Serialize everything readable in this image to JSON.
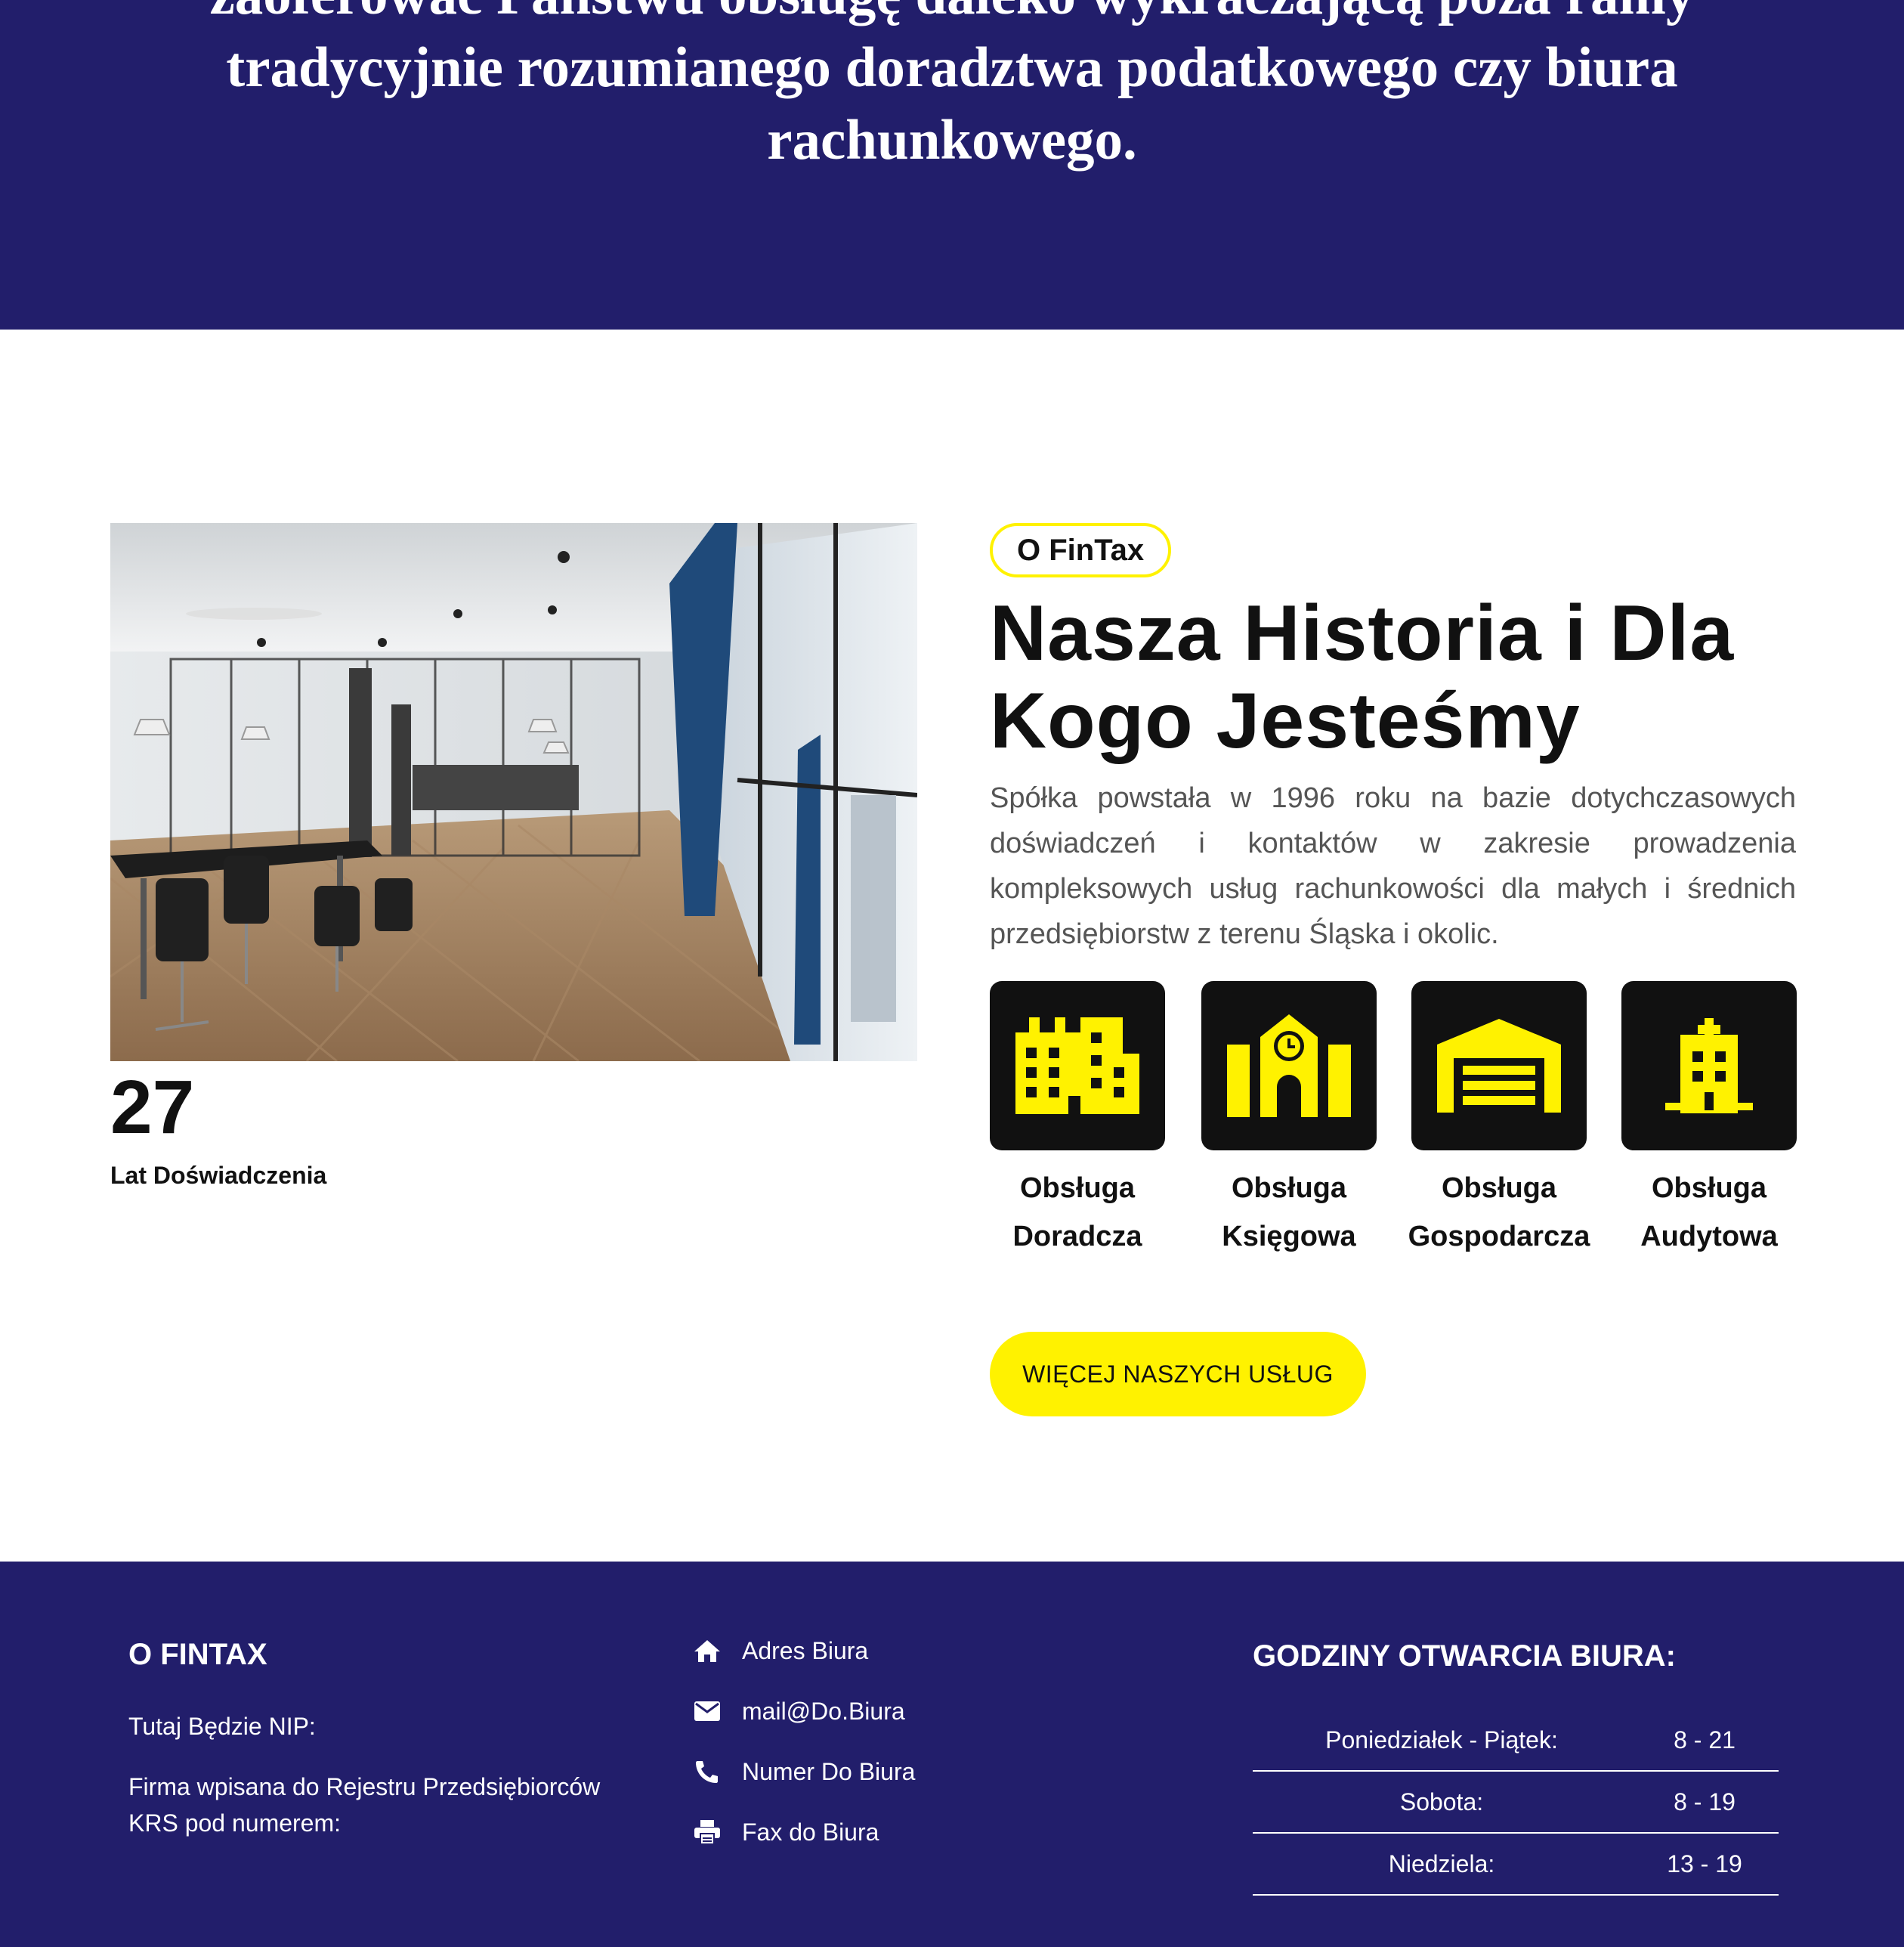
{
  "hero": {
    "line1": "zaoferować Państwu obsługę daleko wykraczającą poza ramy",
    "line2": "tradycyjnie rozumianego doradztwa podatkowego czy biura",
    "line3": "rachunkowego."
  },
  "about": {
    "badge": "O FinTax",
    "heading_line1": "Nasza Historia i Dla",
    "heading_line2": "Kogo Jesteśmy",
    "description": "Spółka powstała w 1996 roku na bazie dotychczasowych doświadczeń i kontaktów w zakresie prowadzenia kompleksowych usług rachunkowości dla małych i średnich przedsiębiorstw z terenu Śląska i okolic.",
    "stat_number": "27",
    "stat_label": "Lat Doświadczenia",
    "image_alt": "office-interior-photo",
    "services": [
      {
        "line1": "Obsługa",
        "line2": "Doradcza",
        "icon": "buildings-icon"
      },
      {
        "line1": "Obsługa",
        "line2": "Księgowa",
        "icon": "school-clock-icon"
      },
      {
        "line1": "Obsługa",
        "line2": "Gospodarcza",
        "icon": "warehouse-icon"
      },
      {
        "line1": "Obsługa",
        "line2": "Audytowa",
        "icon": "hospital-building-icon"
      }
    ],
    "button": "WIĘCEJ NASZYCH USŁUG"
  },
  "footer": {
    "about_title": "O FINTAX",
    "nip": "Tutaj Będzie NIP:",
    "krs_line1": "Firma wpisana do Rejestru Przedsiębiorców",
    "krs_line2": "KRS pod numerem:",
    "contacts": [
      {
        "icon": "home-icon",
        "text": "Adres Biura"
      },
      {
        "icon": "envelope-icon",
        "text": "mail@Do.Biura"
      },
      {
        "icon": "phone-icon",
        "text": "Numer Do Biura"
      },
      {
        "icon": "printer-icon",
        "text": "Fax do Biura"
      }
    ],
    "hours_title": "GODZINY OTWARCIA BIURA:",
    "hours": [
      {
        "day": "Poniedziałek - Piątek:",
        "time": "8 - 21"
      },
      {
        "day": "Sobota:",
        "time": "8 - 19"
      },
      {
        "day": "Niedziela:",
        "time": "13 - 19"
      }
    ]
  },
  "colors": {
    "navy": "#221e6b",
    "accent_yellow": "#fff200",
    "dark": "#111111",
    "text_gray": "#555555"
  }
}
